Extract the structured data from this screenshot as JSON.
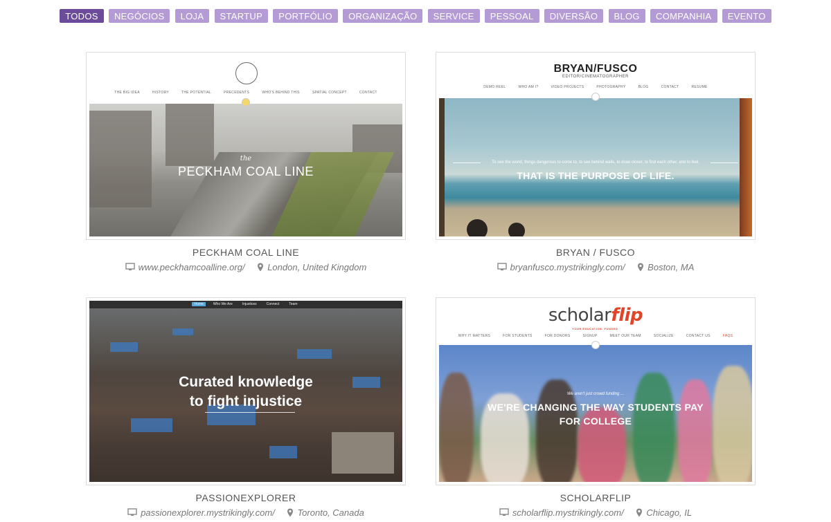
{
  "filters": [
    {
      "label": "TODOS",
      "active": true
    },
    {
      "label": "NEGÓCIOS"
    },
    {
      "label": "LOJA"
    },
    {
      "label": "STARTUP"
    },
    {
      "label": "PORTFÓLIO"
    },
    {
      "label": "ORGANIZAÇÃO"
    },
    {
      "label": "SERVICE"
    },
    {
      "label": "PESSOAL"
    },
    {
      "label": "DIVERSÃO"
    },
    {
      "label": "BLOG"
    },
    {
      "label": "COMPANHIA"
    },
    {
      "label": "EVENTO"
    }
  ],
  "colors": {
    "filter_bg": "#b59bd6",
    "filter_active_bg": "#6b4b9a"
  },
  "cards": [
    {
      "title": "PECKHAM COAL LINE",
      "url": "www.peckhamcoalline.org/",
      "location": "London, United Kingdom",
      "preview": {
        "nav": [
          "THE BIG IDEA",
          "HISTORY",
          "THE POTENTIAL",
          "PRECEDENTS",
          "WHO'S BEHIND THIS",
          "SPATIAL CONCEPT",
          "CONTACT"
        ],
        "hero_small": "the",
        "hero_title": "PECKHAM COAL LINE"
      }
    },
    {
      "title": "BRYAN / FUSCO",
      "url": "bryanfusco.mystrikingly.com/",
      "location": "Boston, MA",
      "preview": {
        "logo": "BRYAN/FUSCO",
        "subtitle": "EDITOR/CINEMATOGRAPHER",
        "nav": [
          "DEMO REEL",
          "WHO AM I?",
          "VIDEO PROJECTS",
          "PHOTOGRAPHY",
          "BLOG",
          "CONTACT",
          "RESUME"
        ],
        "quote": "To see the world, things dangerous to come to, to see behind walls, to draw closer, to find each other, and to feel.",
        "hero_title": "THAT IS THE PURPOSE OF LIFE."
      }
    },
    {
      "title": "PASSIONEXPLORER",
      "url": "passionexplorer.mystrikingly.com/",
      "location": "Toronto, Canada",
      "preview": {
        "nav": [
          "Home",
          "Who We Are",
          "Injustices",
          "Connect",
          "Team"
        ],
        "hero_line1": "Curated knowledge",
        "hero_line2": "to fight injustice"
      }
    },
    {
      "title": "SCHOLARFLIP",
      "url": "scholarflip.mystrikingly.com/",
      "location": "Chicago, IL",
      "preview": {
        "logo_a": "scholar",
        "logo_b": "flip",
        "tagline": "YOUR EDUCATION. FUNDED.",
        "nav": [
          "WHY IT MATTERS",
          "FOR STUDENTS",
          "FOR DONORS",
          "SIGNUP",
          "MEET OUR TEAM",
          "SOCIALIZE",
          "CONTACT US",
          "FAQS"
        ],
        "hero_small": "We aren't just crowd funding ...",
        "hero_line1": "WE'RE CHANGING THE WAY STUDENTS PAY",
        "hero_line2": "FOR COLLEGE"
      }
    }
  ]
}
